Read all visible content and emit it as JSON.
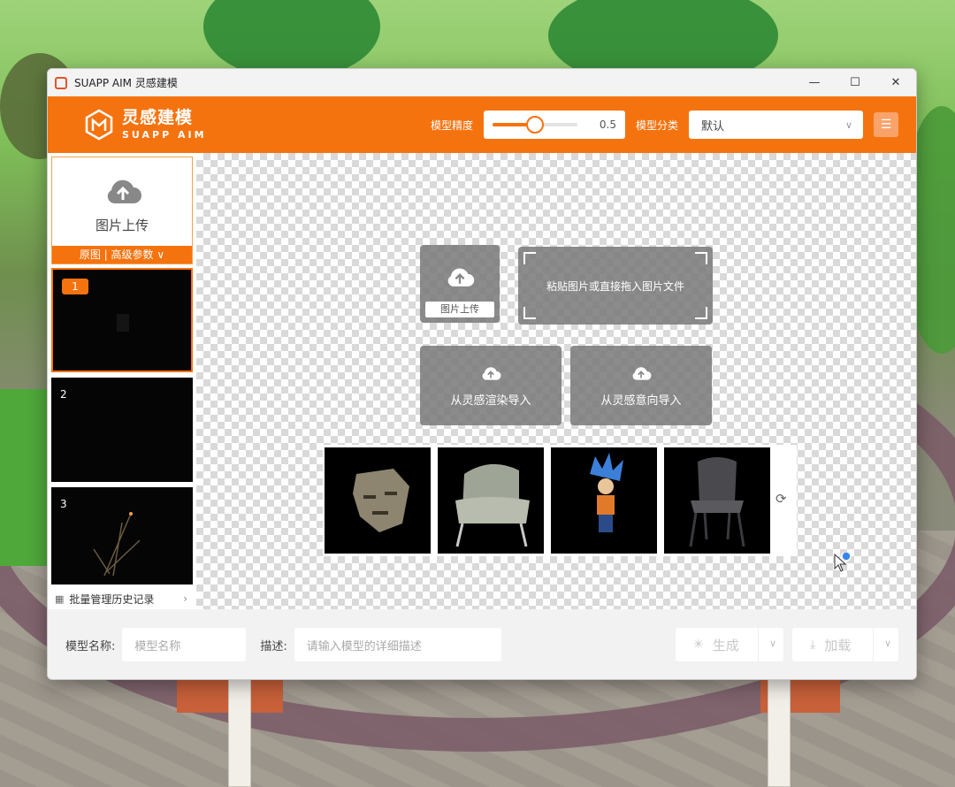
{
  "window": {
    "title": "SUAPP AIM 灵感建模",
    "controls": [
      "—",
      "☐",
      "✕"
    ]
  },
  "header": {
    "logo_cn": "灵感建模",
    "logo_en": "SUAPP AIM",
    "precision_label": "模型精度",
    "precision_value": "0.5",
    "precision_fraction": 0.5,
    "category_label": "模型分类",
    "category_value": "默认",
    "menu_icon": "hamburger-icon",
    "accent_color": "#f5730f"
  },
  "sidebar": {
    "upload_label": "图片上传",
    "upload_bar": "原图 | 高级参数 ∨",
    "thumbnails": [
      {
        "num": "1",
        "selected": true
      },
      {
        "num": "2",
        "selected": false
      },
      {
        "num": "3",
        "selected": false
      }
    ],
    "history_label": "批量管理历史记录"
  },
  "canvas": {
    "upload_tile_label": "图片上传",
    "paste_tile_label": "粘贴图片或直接拖入图片文件",
    "import_render_label": "从灵感渲染导入",
    "import_intent_label": "从灵感意向导入",
    "samples": [
      "mask-sample",
      "armchair-sample",
      "figure-sample",
      "chair-sample"
    ],
    "refresh_icon": "refresh-icon"
  },
  "footer": {
    "name_label": "模型名称:",
    "name_placeholder": "模型名称",
    "desc_label": "描述:",
    "desc_placeholder": "请输入模型的详细描述",
    "generate_label": "生成",
    "load_label": "加载"
  }
}
